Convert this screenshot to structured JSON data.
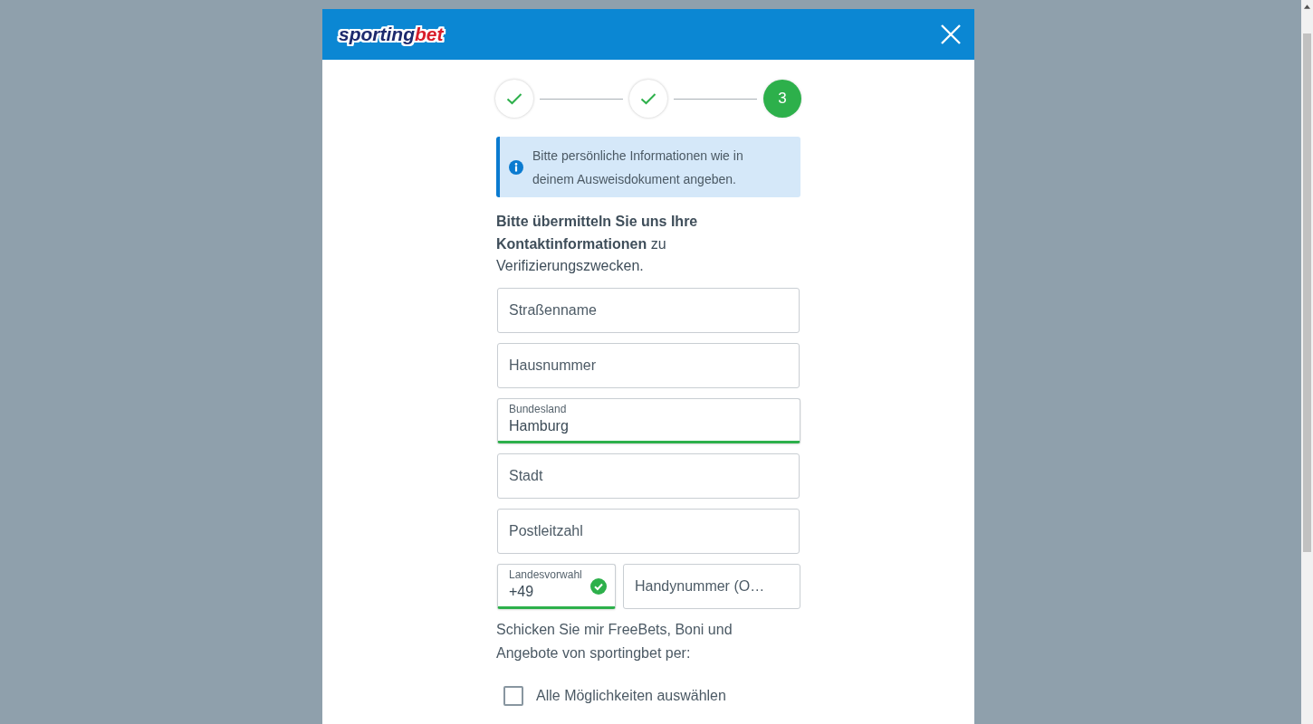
{
  "header": {
    "logo": {
      "primary": "sporting",
      "accent": "bet"
    }
  },
  "steps": [
    {
      "completed": true,
      "current": false
    },
    {
      "completed": true,
      "current": false
    },
    {
      "completed": false,
      "current": true,
      "label": "3"
    }
  ],
  "notice": {
    "text": "Bitte persönliche Informationen wie in deinem Ausweisdokument angeben."
  },
  "intro": "**Bitte übermitteln Sie uns Ihre Kontaktinformationen** zu Verifizierungszwecken.",
  "fields": [
    {
      "kind": "text",
      "placeholder": "Straßenname",
      "valid": false
    },
    {
      "kind": "text",
      "placeholder": "Hausnummer",
      "valid": false
    },
    {
      "kind": "select",
      "label": "Bundesland",
      "value": "Hamburg",
      "valid": true
    },
    {
      "kind": "text",
      "placeholder": "Stadt",
      "valid": false
    },
    {
      "kind": "text",
      "placeholder": "Postleitzahl",
      "valid": false
    }
  ],
  "phone": {
    "country_code": {
      "label": "Landesvorwahl",
      "value": "+49",
      "valid": true
    },
    "number": {
      "placeholder": "Handynummer (O…"
    }
  },
  "marketing": {
    "text": "Schicken Sie mir FreeBets, Boni und Angebote von sportingbet per:",
    "select_all": {
      "label": "Alle Möglichkeiten auswählen",
      "checked": false
    }
  }
}
